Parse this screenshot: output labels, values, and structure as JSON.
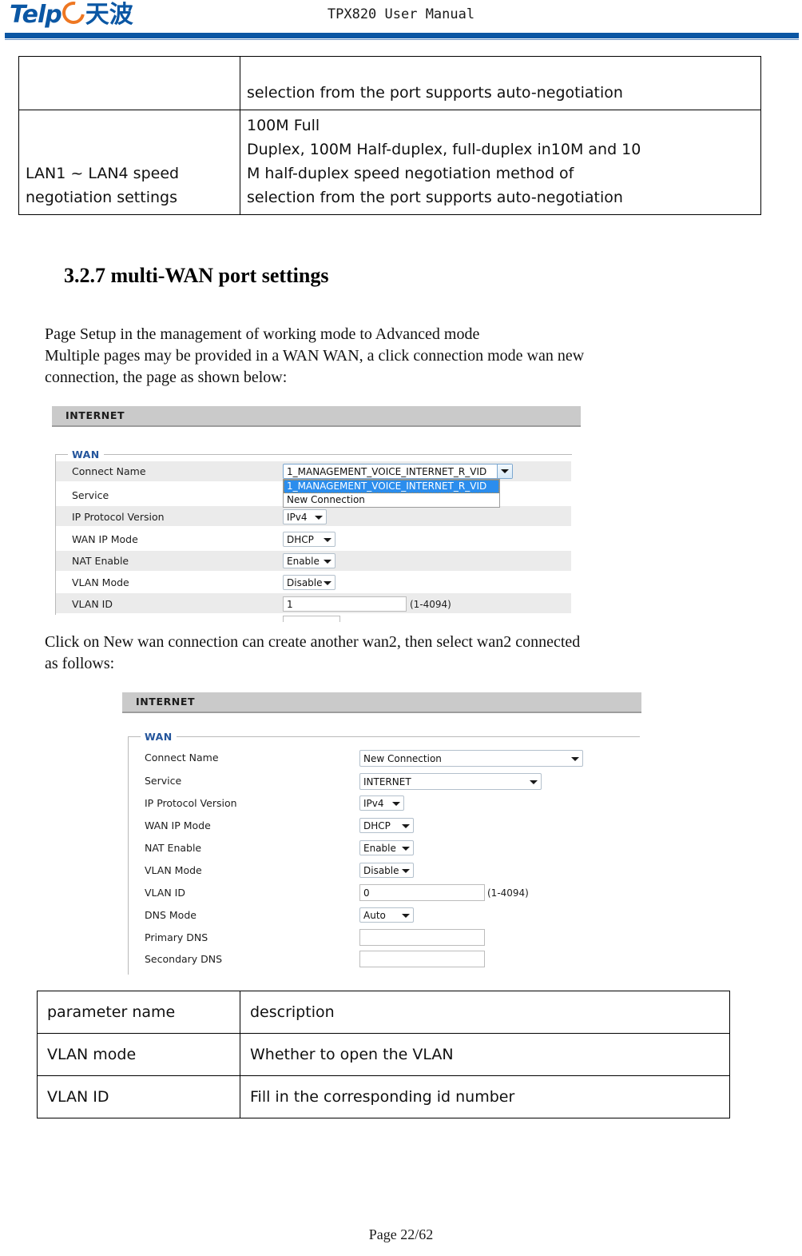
{
  "header": {
    "logo_text": "Telp",
    "logo_cn": "天波",
    "manual_title": "TPX820 User Manual",
    "brand_blue": "#0b57a4",
    "brand_orange": "#ee7722"
  },
  "spec_table": {
    "rows": [
      {
        "param": "",
        "desc_lines": [
          "selection from the port supports auto-negotiation"
        ]
      },
      {
        "param": "LAN1 ~ LAN4 speed negotiation settings",
        "desc_lines": [
          "100M Full",
          "Duplex, 100M Half-duplex, full-duplex in10M and 10",
          "M half-duplex speed negotiation method of",
          "selection from the port supports auto-negotiation"
        ]
      }
    ]
  },
  "section": {
    "heading": "3.2.7 multi-WAN port settings",
    "para_1_line_1": "Page Setup in the management of working mode to Advanced mode",
    "para_1_line_2": "Multiple pages may be provided in a WAN WAN, a click connection mode wan new",
    "para_1_line_3": "connection, the page as shown below:",
    "para_2_line_1": "Click on New wan connection can create another wan2, then select wan2 connected",
    "para_2_line_2": "as follows:"
  },
  "screenshot_1": {
    "title_bar": "INTERNET",
    "legend": "WAN",
    "rows": [
      {
        "label": "Connect Name",
        "value": "1_MANAGEMENT_VOICE_INTERNET_R_VID",
        "control": "select-open"
      },
      {
        "label": "Service",
        "value": "",
        "control": "hidden-by-dropdown"
      },
      {
        "label": "IP Protocol Version",
        "value": "IPv4",
        "control": "select"
      },
      {
        "label": "WAN IP Mode",
        "value": "DHCP",
        "control": "select"
      },
      {
        "label": "NAT Enable",
        "value": "Enable",
        "control": "select"
      },
      {
        "label": "VLAN Mode",
        "value": "Disable",
        "control": "select"
      },
      {
        "label": "VLAN ID",
        "value": "1",
        "control": "text",
        "hint": "(1-4094)"
      }
    ],
    "dropdown_options": [
      "1_MANAGEMENT_VOICE_INTERNET_R_VID",
      "New Connection"
    ],
    "dropdown_selected_index": 0
  },
  "screenshot_2": {
    "title_bar": "INTERNET",
    "legend": "WAN",
    "rows": [
      {
        "label": "Connect Name",
        "value": "New Connection",
        "control": "select"
      },
      {
        "label": "Service",
        "value": "INTERNET",
        "control": "select"
      },
      {
        "label": "IP Protocol Version",
        "value": "IPv4",
        "control": "select"
      },
      {
        "label": "WAN IP Mode",
        "value": "DHCP",
        "control": "select"
      },
      {
        "label": "NAT Enable",
        "value": "Enable",
        "control": "select"
      },
      {
        "label": "VLAN Mode",
        "value": "Disable",
        "control": "select"
      },
      {
        "label": "VLAN ID",
        "value": "0",
        "control": "text",
        "hint": "(1-4094)"
      },
      {
        "label": "DNS Mode",
        "value": "Auto",
        "control": "select"
      },
      {
        "label": "Primary DNS",
        "value": "",
        "control": "text"
      },
      {
        "label": "Secondary DNS",
        "value": "",
        "control": "text"
      }
    ]
  },
  "param_table": {
    "headers": [
      "parameter name",
      "description"
    ],
    "rows": [
      [
        "VLAN mode",
        "Whether to open the VLAN"
      ],
      [
        "VLAN ID",
        "Fill in the corresponding id number"
      ]
    ]
  },
  "footer": {
    "page_label": "Page 22/62"
  }
}
